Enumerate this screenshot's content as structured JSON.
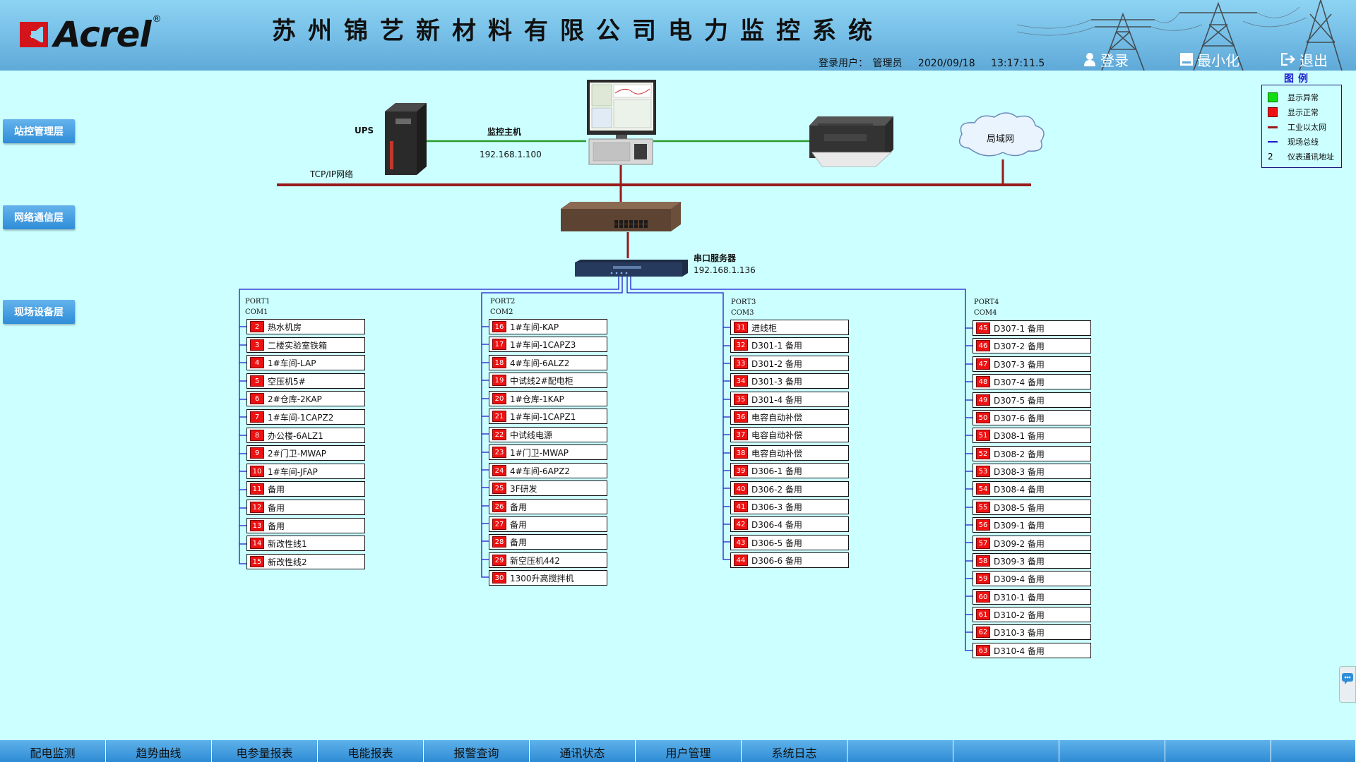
{
  "header": {
    "logo_text": "Acrel",
    "logo_reg": "®",
    "title": "苏州锦艺新材料有限公司电力监控系统",
    "login_label": "登录用户：",
    "login_user": "管理员",
    "date": "2020/09/18",
    "time": "13:17:11.5",
    "btn_login": "登录",
    "btn_minimize": "最小化",
    "btn_exit": "退出"
  },
  "layers": {
    "station": "站控管理层",
    "network": "网络通信层",
    "field": "现场设备层"
  },
  "legend": {
    "title": "图例",
    "items": [
      {
        "label": "显示异常",
        "symbol": "green-square",
        "color": "#11dd11"
      },
      {
        "label": "显示正常",
        "symbol": "red-square",
        "color": "#ee1111"
      },
      {
        "label": "工业以太网",
        "symbol": "dark-red-line",
        "color": "#991a1a"
      },
      {
        "label": "现场总线",
        "symbol": "blue-line",
        "color": "#1a1acc"
      },
      {
        "label": "仪表通讯地址",
        "symbol": "2"
      }
    ]
  },
  "network": {
    "ups_label": "UPS",
    "host_label": "监控主机",
    "host_ip": "192.168.1.100",
    "tcpip_label": "TCP/IP网络",
    "lan_label": "局域网",
    "serial_label": "串口服务器",
    "serial_ip": "192.168.1.136"
  },
  "ports": [
    {
      "port": "PORT1",
      "com": "COM1",
      "devices": [
        {
          "id": "2",
          "name": "热水机房"
        },
        {
          "id": "3",
          "name": "二楼实验室铁箱"
        },
        {
          "id": "4",
          "name": "1#车间-LAP"
        },
        {
          "id": "5",
          "name": "空压机5#"
        },
        {
          "id": "6",
          "name": "2#仓库-2KAP"
        },
        {
          "id": "7",
          "name": "1#车间-1CAPZ2"
        },
        {
          "id": "8",
          "name": "办公楼-6ALZ1"
        },
        {
          "id": "9",
          "name": "2#门卫-MWAP"
        },
        {
          "id": "10",
          "name": "1#车间-JFAP"
        },
        {
          "id": "11",
          "name": "备用"
        },
        {
          "id": "12",
          "name": "备用"
        },
        {
          "id": "13",
          "name": "备用"
        },
        {
          "id": "14",
          "name": "新改性线1"
        },
        {
          "id": "15",
          "name": "新改性线2"
        }
      ]
    },
    {
      "port": "PORT2",
      "com": "COM2",
      "devices": [
        {
          "id": "16",
          "name": "1#车间-KAP"
        },
        {
          "id": "17",
          "name": "1#车间-1CAPZ3"
        },
        {
          "id": "18",
          "name": "4#车间-6ALZ2"
        },
        {
          "id": "19",
          "name": "中试线2#配电柜"
        },
        {
          "id": "20",
          "name": "1#仓库-1KAP"
        },
        {
          "id": "21",
          "name": "1#车间-1CAPZ1"
        },
        {
          "id": "22",
          "name": "中试线电源"
        },
        {
          "id": "23",
          "name": "1#门卫-MWAP"
        },
        {
          "id": "24",
          "name": "4#车间-6APZ2"
        },
        {
          "id": "25",
          "name": "3F研发"
        },
        {
          "id": "26",
          "name": "备用"
        },
        {
          "id": "27",
          "name": "备用"
        },
        {
          "id": "28",
          "name": "备用"
        },
        {
          "id": "29",
          "name": "新空压机442"
        },
        {
          "id": "30",
          "name": "1300升高搅拌机"
        }
      ]
    },
    {
      "port": "PORT3",
      "com": "COM3",
      "devices": [
        {
          "id": "31",
          "name": "进线柜"
        },
        {
          "id": "32",
          "name": "D301-1 备用"
        },
        {
          "id": "33",
          "name": "D301-2 备用"
        },
        {
          "id": "34",
          "name": "D301-3 备用"
        },
        {
          "id": "35",
          "name": "D301-4 备用"
        },
        {
          "id": "36",
          "name": "电容自动补偿"
        },
        {
          "id": "37",
          "name": "电容自动补偿"
        },
        {
          "id": "38",
          "name": "电容自动补偿"
        },
        {
          "id": "39",
          "name": "D306-1 备用"
        },
        {
          "id": "40",
          "name": "D306-2 备用"
        },
        {
          "id": "41",
          "name": "D306-3 备用"
        },
        {
          "id": "42",
          "name": "D306-4 备用"
        },
        {
          "id": "43",
          "name": "D306-5 备用"
        },
        {
          "id": "44",
          "name": "D306-6 备用"
        }
      ]
    },
    {
      "port": "PORT4",
      "com": "COM4",
      "devices": [
        {
          "id": "45",
          "name": "D307-1 备用"
        },
        {
          "id": "46",
          "name": "D307-2 备用"
        },
        {
          "id": "47",
          "name": "D307-3 备用"
        },
        {
          "id": "48",
          "name": "D307-4 备用"
        },
        {
          "id": "49",
          "name": "D307-5 备用"
        },
        {
          "id": "50",
          "name": "D307-6 备用"
        },
        {
          "id": "51",
          "name": "D308-1 备用"
        },
        {
          "id": "52",
          "name": "D308-2 备用"
        },
        {
          "id": "53",
          "name": "D308-3 备用"
        },
        {
          "id": "54",
          "name": "D308-4 备用"
        },
        {
          "id": "55",
          "name": "D308-5 备用"
        },
        {
          "id": "56",
          "name": "D309-1 备用"
        },
        {
          "id": "57",
          "name": "D309-2 备用"
        },
        {
          "id": "58",
          "name": "D309-3 备用"
        },
        {
          "id": "59",
          "name": "D309-4 备用"
        },
        {
          "id": "60",
          "name": "D310-1 备用"
        },
        {
          "id": "61",
          "name": "D310-2 备用"
        },
        {
          "id": "62",
          "name": "D310-3 备用"
        },
        {
          "id": "63",
          "name": "D310-4 备用"
        }
      ]
    }
  ],
  "bottom_nav": [
    "配电监测",
    "趋势曲线",
    "电参量报表",
    "电能报表",
    "报警查询",
    "通讯状态",
    "用户管理",
    "系统日志",
    "",
    "",
    "",
    "",
    ""
  ]
}
